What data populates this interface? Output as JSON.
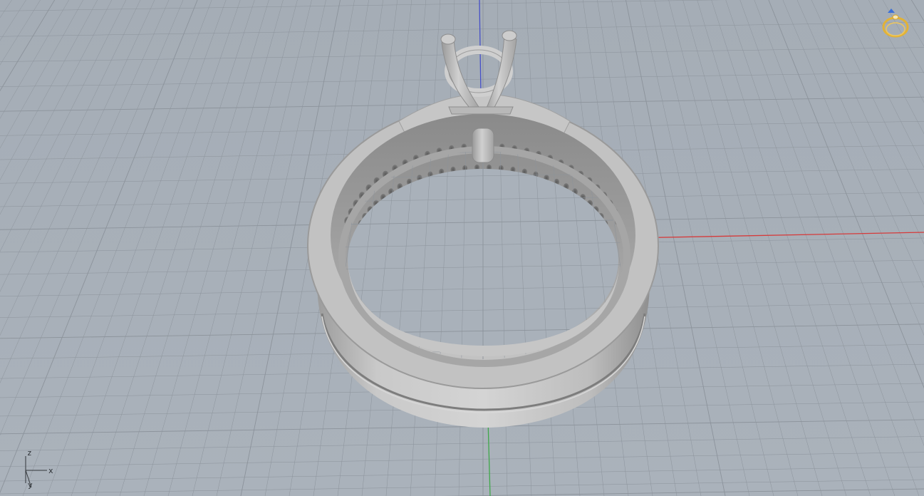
{
  "viewport": {
    "axis_labels": {
      "z": "z",
      "x": "x",
      "y": "y"
    },
    "axis_colors": {
      "x": "#d63a3a",
      "y": "#3fa84a",
      "z": "#4650c8"
    },
    "grid_color": "#8c939b",
    "background": "#a7afb8",
    "model": {
      "icon": "ring-model",
      "material_color": "#c8c8c8"
    },
    "view_cube_icon": "ring-icon",
    "view_cube_color": "#e2b236"
  }
}
